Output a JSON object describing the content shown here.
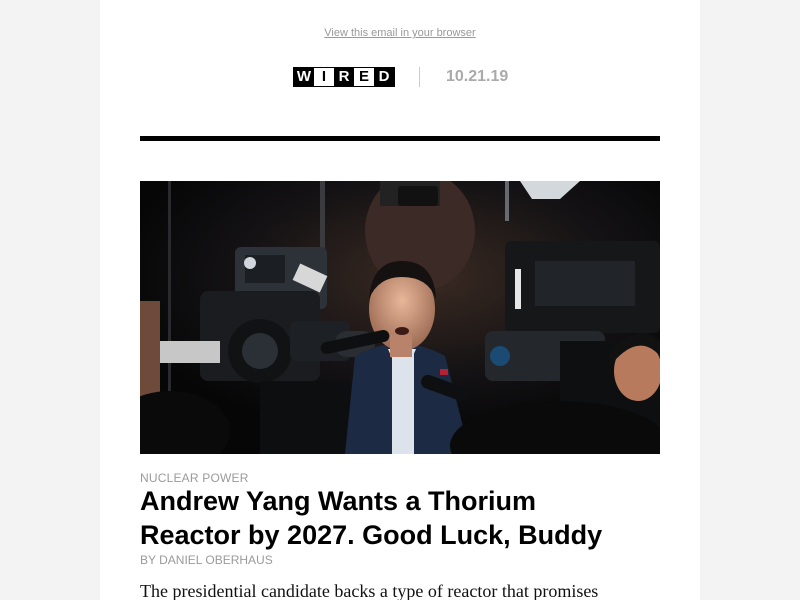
{
  "header": {
    "view_in_browser": "View this email in your browser",
    "logo_letters": [
      "W",
      "I",
      "R",
      "E",
      "D"
    ],
    "date": "10.21.19"
  },
  "article": {
    "image_alt": "Andrew Yang speaking to press cameras",
    "kicker": "NUCLEAR POWER",
    "headline_line1": "Andrew Yang Wants a Thorium",
    "headline_line2": "Reactor by 2027. Good Luck, Buddy",
    "byline": "BY DANIEL OBERHAUS",
    "dek": "The presidential candidate backs a type of reactor that promises"
  },
  "colors": {
    "page_background": "#f3f3f3",
    "email_background": "#ffffff",
    "muted_text": "#9a9a9a",
    "headline_text": "#000000",
    "rule": "#000000"
  }
}
